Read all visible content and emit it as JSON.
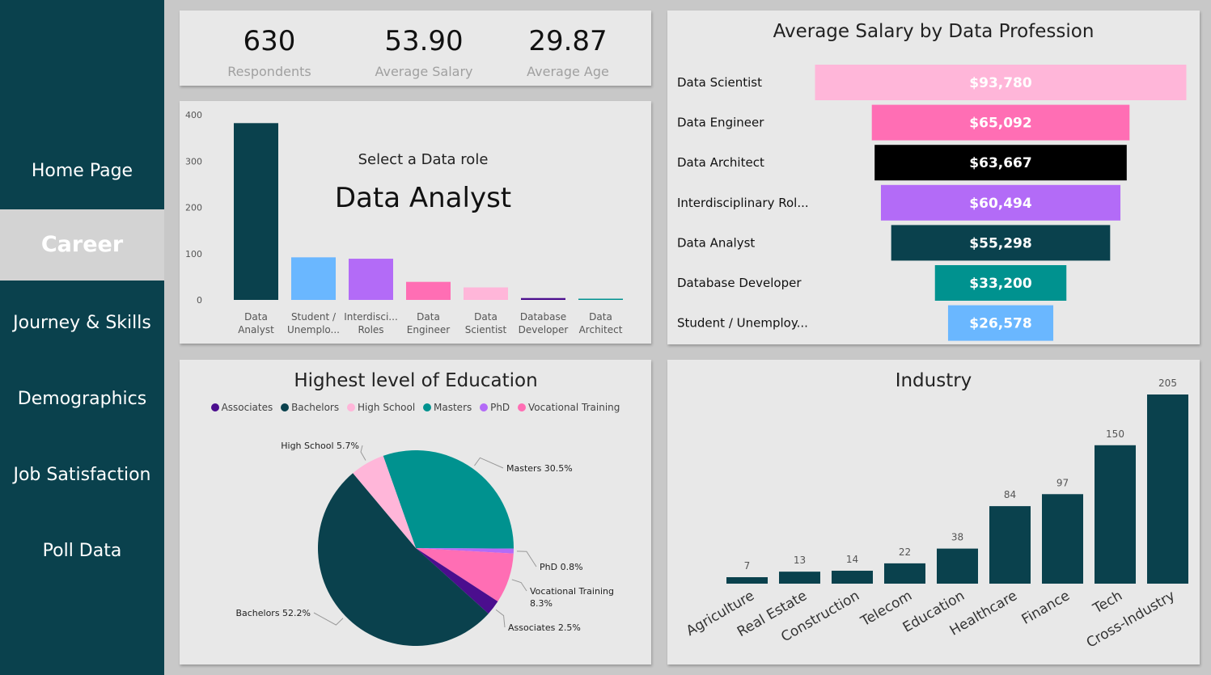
{
  "nav": {
    "items": [
      {
        "label": "Home Page",
        "active": false
      },
      {
        "label": "Career",
        "active": true
      },
      {
        "label": "Journey & Skills",
        "active": false
      },
      {
        "label": "Demographics",
        "active": false
      },
      {
        "label": "Job Satisfaction",
        "active": false
      },
      {
        "label": "Poll Data",
        "active": false
      }
    ]
  },
  "kpis": [
    {
      "value": "630",
      "label": "Respondents"
    },
    {
      "value": "53.90",
      "label": "Average Salary"
    },
    {
      "value": "29.87",
      "label": "Average Age"
    }
  ],
  "role_selector": {
    "prompt": "Select a Data role",
    "selected": "Data Analyst"
  },
  "colors": {
    "teal_dark": "#0a414d",
    "light_blue": "#6ab7ff",
    "purple": "#b36bf7",
    "pink": "#ff6eb4",
    "light_pink": "#ffb6d9",
    "indigo": "#4b0e8e",
    "teal": "#00928f",
    "black": "#000000"
  },
  "chart_data": [
    {
      "id": "role_counts",
      "type": "bar",
      "title": "",
      "categories": [
        [
          "Data",
          "Analyst"
        ],
        [
          "Student /",
          "Unemplo..."
        ],
        [
          "Interdisci...",
          "Roles"
        ],
        [
          "Data",
          "Engineer"
        ],
        [
          "Data",
          "Scientist"
        ],
        [
          "Database",
          "Developer"
        ],
        [
          "Data",
          "Architect"
        ]
      ],
      "values": [
        382,
        92,
        89,
        39,
        27,
        4,
        2
      ],
      "colors": [
        "#0a414d",
        "#6ab7ff",
        "#b36bf7",
        "#ff6eb4",
        "#ffb6d9",
        "#4b0e8e",
        "#00928f"
      ],
      "yticks": [
        0,
        100,
        200,
        300,
        400
      ],
      "ylim": [
        0,
        400
      ],
      "grid": false
    },
    {
      "id": "salary_funnel",
      "type": "bar",
      "title": "Average Salary by Data Profession",
      "categories": [
        "Data Scientist",
        "Data Engineer",
        "Data Architect",
        "Interdisciplinary Rol...",
        "Data Analyst",
        "Database Developer",
        "Student / Unemploy..."
      ],
      "values": [
        93780,
        65092,
        63667,
        60494,
        55298,
        33200,
        26578
      ],
      "labels": [
        "$93,780",
        "$65,092",
        "$63,667",
        "$60,494",
        "$55,298",
        "$33,200",
        "$26,578"
      ],
      "colors": [
        "#ffb6d9",
        "#ff6eb4",
        "#000000",
        "#b36bf7",
        "#0a414d",
        "#00928f",
        "#6ab7ff"
      ]
    },
    {
      "id": "education_pie",
      "type": "pie",
      "title": "Highest level of Education",
      "legend": [
        "Associates",
        "Bachelors",
        "High School",
        "Masters",
        "PhD",
        "Vocational Training"
      ],
      "legend_colors": [
        "#4b0e8e",
        "#0a414d",
        "#ffb6d9",
        "#00928f",
        "#b36bf7",
        "#ff6eb4"
      ],
      "slices": [
        {
          "name": "Masters",
          "value": 30.5,
          "color": "#00928f",
          "label": "Masters 30.5%"
        },
        {
          "name": "PhD",
          "value": 0.8,
          "color": "#b36bf7",
          "label": "PhD 0.8%"
        },
        {
          "name": "Vocational Training",
          "value": 8.3,
          "color": "#ff6eb4",
          "label": "Vocational Training 8.3%"
        },
        {
          "name": "Associates",
          "value": 2.5,
          "color": "#4b0e8e",
          "label": "Associates 2.5%"
        },
        {
          "name": "Bachelors",
          "value": 52.2,
          "color": "#0a414d",
          "label": "Bachelors 52.2%"
        },
        {
          "name": "High School",
          "value": 5.7,
          "color": "#ffb6d9",
          "label": "High School 5.7%"
        }
      ]
    },
    {
      "id": "industry",
      "type": "bar",
      "title": "Industry",
      "categories": [
        "Agriculture",
        "Real Estate",
        "Construction",
        "Telecom",
        "Education",
        "Healthcare",
        "Finance",
        "Tech",
        "Cross-Industry"
      ],
      "values": [
        7,
        13,
        14,
        22,
        38,
        84,
        97,
        150,
        205
      ],
      "color": "#0a414d",
      "ylim": [
        0,
        205
      ]
    }
  ]
}
